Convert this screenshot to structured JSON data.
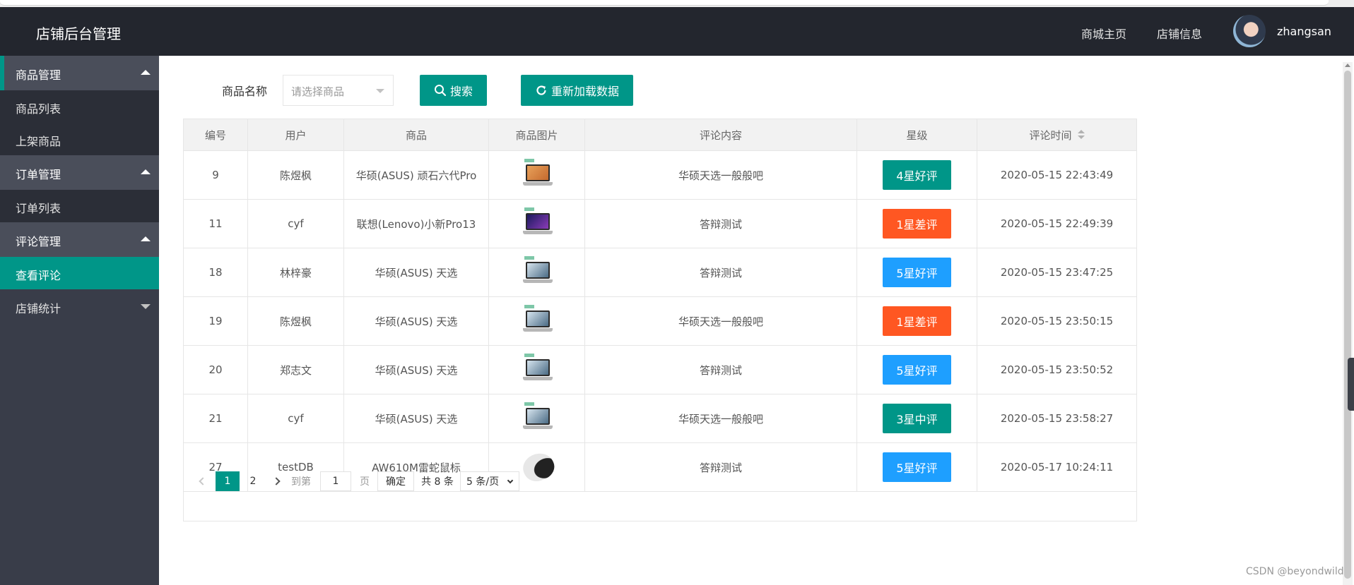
{
  "header": {
    "title": "店铺后台管理",
    "links": [
      "商城主页",
      "店铺信息"
    ],
    "username": "zhangsan"
  },
  "sidebar": {
    "groups": [
      {
        "label": "商品管理",
        "items": [
          "商品列表",
          "上架商品"
        ]
      },
      {
        "label": "订单管理",
        "items": [
          "订单列表"
        ]
      },
      {
        "label": "评论管理",
        "items": [
          "查看评论"
        ]
      },
      {
        "label": "店铺统计",
        "items": []
      }
    ],
    "active_item": "查看评论"
  },
  "filter": {
    "label": "商品名称",
    "placeholder": "请选择商品",
    "search_label": "搜索",
    "reload_label": "重新加载数据"
  },
  "table": {
    "columns": [
      "编号",
      "用户",
      "商品",
      "商品图片",
      "评论内容",
      "星级",
      "评论时间"
    ],
    "rows": [
      {
        "id": "9",
        "user": "陈煜枫",
        "product": "华硕(ASUS) 顽石六代Pro",
        "image": "laptop-icon",
        "comment": "华硕天选一般般吧",
        "rating": "4星好评",
        "rating_color": "#009688",
        "time": "2020-05-15 22:43:49"
      },
      {
        "id": "11",
        "user": "cyf",
        "product": "联想(Lenovo)小新Pro13",
        "image": "laptop-icon",
        "comment": "答辩测试",
        "rating": "1星差评",
        "rating_color": "#ff5722",
        "time": "2020-05-15 22:49:39"
      },
      {
        "id": "18",
        "user": "林梓豪",
        "product": "华硕(ASUS) 天选",
        "image": "laptop-icon",
        "comment": "答辩测试",
        "rating": "5星好评",
        "rating_color": "#1e9fff",
        "time": "2020-05-15 23:47:25"
      },
      {
        "id": "19",
        "user": "陈煜枫",
        "product": "华硕(ASUS) 天选",
        "image": "laptop-icon",
        "comment": "华硕天选一般般吧",
        "rating": "1星差评",
        "rating_color": "#ff5722",
        "time": "2020-05-15 23:50:15"
      },
      {
        "id": "20",
        "user": "郑志文",
        "product": "华硕(ASUS) 天选",
        "image": "laptop-icon",
        "comment": "答辩测试",
        "rating": "5星好评",
        "rating_color": "#1e9fff",
        "time": "2020-05-15 23:50:52"
      },
      {
        "id": "21",
        "user": "cyf",
        "product": "华硕(ASUS) 天选",
        "image": "laptop-icon",
        "comment": "华硕天选一般般吧",
        "rating": "3星中评",
        "rating_color": "#009688",
        "time": "2020-05-15 23:58:27"
      },
      {
        "id": "27",
        "user": "testDB",
        "product": "AW610M雷蛇鼠标",
        "image": "mouse-icon",
        "comment": "答辩测试",
        "rating": "5星好评",
        "rating_color": "#1e9fff",
        "time": "2020-05-17 10:24:11"
      }
    ]
  },
  "pagination": {
    "current": "1",
    "page2": "2",
    "goto_label": "到第",
    "goto_value": "1",
    "page_unit": "页",
    "confirm_label": "确定",
    "total_text": "共 8 条",
    "page_size": "5 条/页"
  },
  "watermark": "CSDN @beyondwild",
  "colors": {
    "accent": "#009688",
    "danger": "#ff5722",
    "info": "#1e9fff",
    "header_bg": "#23262e",
    "sidebar_bg": "#393d49"
  }
}
